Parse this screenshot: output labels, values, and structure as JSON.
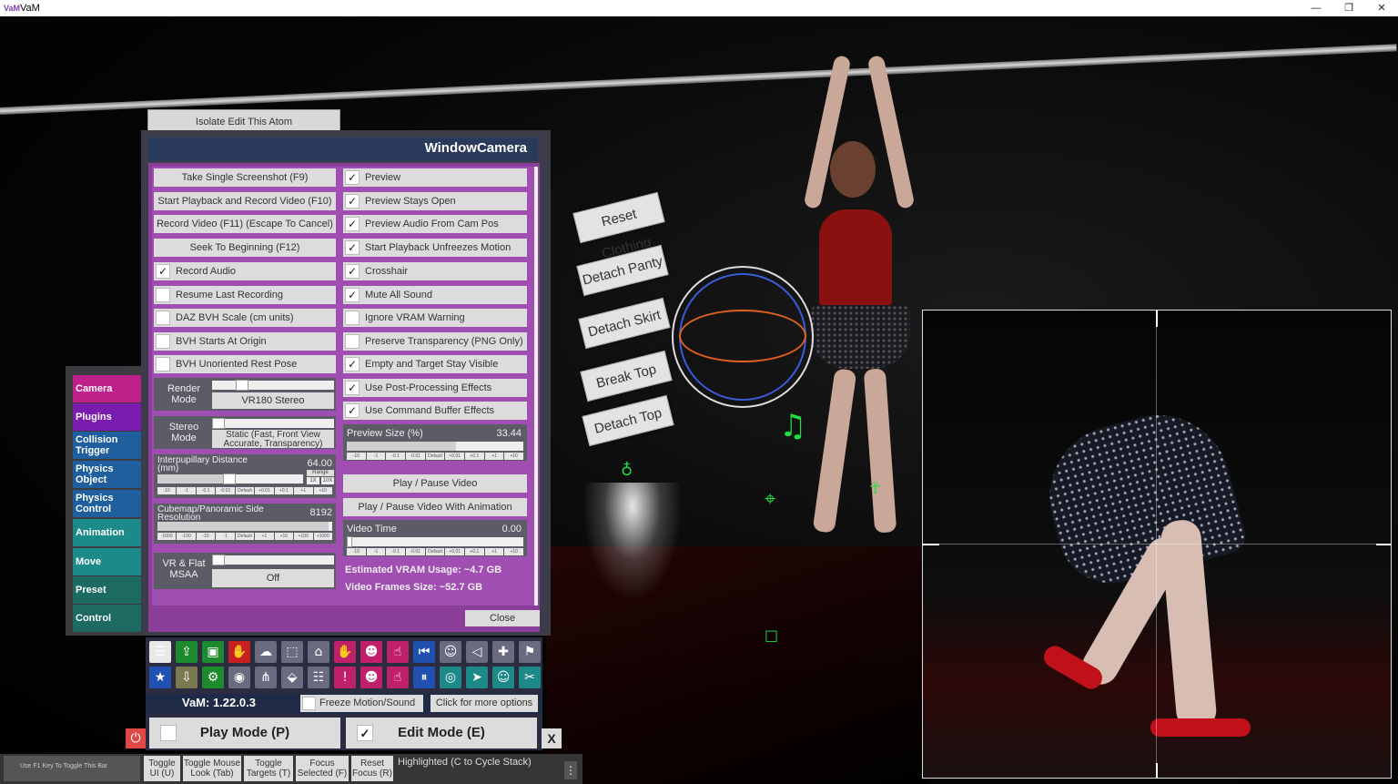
{
  "window": {
    "title": "VaM",
    "app_icon": "VaM",
    "min": "—",
    "restore": "❐",
    "close": "✕"
  },
  "scene": {
    "tags": [
      "Reset Clothing",
      "Detach Panty",
      "Detach Skirt",
      "Break Top",
      "Detach Top"
    ]
  },
  "isolate_button": "Isolate Edit This Atom",
  "tabs": [
    {
      "label": "Camera",
      "color": "#c0208a"
    },
    {
      "label": "Plugins",
      "color": "#7a1cae"
    },
    {
      "label": "Collision Trigger",
      "color": "#1f5f9e"
    },
    {
      "label": "Physics Object",
      "color": "#1f5f9e"
    },
    {
      "label": "Physics Control",
      "color": "#1f5f9e"
    },
    {
      "label": "Animation",
      "color": "#1c8a88"
    },
    {
      "label": "Move",
      "color": "#1c8a88"
    },
    {
      "label": "Preset",
      "color": "#1c6a60"
    },
    {
      "label": "Control",
      "color": "#1c6a60"
    }
  ],
  "panel": {
    "title": "WindowCamera",
    "left_buttons": [
      "Take Single Screenshot (F9)",
      "Start Playback and Record Video (F10)",
      "Record Video (F11) (Escape To Cancel)",
      "Seek To Beginning (F12)"
    ],
    "left_checks": [
      {
        "label": "Record Audio",
        "checked": "✓"
      },
      {
        "label": "Resume Last Recording",
        "checked": ""
      },
      {
        "label": "DAZ BVH Scale (cm units)",
        "checked": ""
      },
      {
        "label": "BVH Starts At Origin",
        "checked": ""
      },
      {
        "label": "BVH Unoriented Rest Pose",
        "checked": ""
      }
    ],
    "right_checks": [
      {
        "label": "Preview",
        "checked": "✓"
      },
      {
        "label": "Preview Stays Open",
        "checked": "✓"
      },
      {
        "label": "Preview Audio From Cam Pos",
        "checked": "✓"
      },
      {
        "label": "Start Playback Unfreezes Motion",
        "checked": "✓"
      },
      {
        "label": "Crosshair",
        "checked": "✓"
      },
      {
        "label": "Mute All Sound",
        "checked": "✓"
      },
      {
        "label": "Ignore VRAM Warning",
        "checked": ""
      },
      {
        "label": "Preserve Transparency (PNG Only)",
        "checked": ""
      },
      {
        "label": "Empty and Target Stay Visible",
        "checked": "✓"
      },
      {
        "label": "Use Post-Processing Effects",
        "checked": "✓"
      },
      {
        "label": "Use Command Buffer Effects",
        "checked": "✓"
      }
    ],
    "render_mode": {
      "label": "Render Mode",
      "value": "VR180 Stereo"
    },
    "stereo_mode": {
      "label": "Stereo Mode",
      "value": "Static (Fast, Front View Accurate, Transparency)"
    },
    "ipd": {
      "label": "Interpupillary Distance (mm)",
      "value": "64.00",
      "range_label": "Range",
      "range_1x": "1X",
      "range_10x": "10X"
    },
    "cubemap": {
      "label": "Cubemap/Panoramic Side Resolution",
      "value": "8192"
    },
    "msaa": {
      "label": "VR & Flat MSAA",
      "value": "Off"
    },
    "preview_size": {
      "label": "Preview Size (%)",
      "value": "33.44",
      "fraction": 0.62
    },
    "play_pause": "Play / Pause Video",
    "play_pause_anim": "Play / Pause Video With Animation",
    "video_time": {
      "label": "Video Time",
      "value": "0.00"
    },
    "vram": "Estimated VRAM Usage: ~4.7 GB",
    "frames": "Video Frames Size: ~52.7 GB",
    "close": "Close",
    "stepper_small": [
      "-10",
      "-1",
      "-0.1",
      "-0.01",
      "Default",
      "+0.01",
      "+0.1",
      "+1",
      "+10"
    ],
    "stepper_big": [
      "-1000",
      "-100",
      "-10",
      "-1",
      "Default",
      "+1",
      "+10",
      "+100",
      "+1000"
    ]
  },
  "toolbar": {
    "row1": [
      {
        "icon": "☰",
        "name": "menu-icon",
        "color": "#e8e8e8"
      },
      {
        "icon": "⇪",
        "name": "open-scene-icon",
        "color": "#1e8a2e"
      },
      {
        "icon": "▣",
        "name": "folder-icon",
        "color": "#1e8a2e"
      },
      {
        "icon": "✋",
        "name": "hand-red-icon",
        "color": "#c82020"
      },
      {
        "icon": "☁",
        "name": "cloud-icon",
        "color": "#6a6a80"
      },
      {
        "icon": "⬚",
        "name": "cube-icon",
        "color": "#6a6a80"
      },
      {
        "icon": "⌂",
        "name": "hub-icon",
        "color": "#6a6a80"
      },
      {
        "icon": "✋",
        "name": "grab-icon",
        "color": "#c0206a"
      },
      {
        "icon": "☻",
        "name": "person-add-icon",
        "color": "#c0206a"
      },
      {
        "icon": "☝",
        "name": "pointer-hand-icon",
        "color": "#c0206a"
      },
      {
        "icon": "⏮",
        "name": "rewind-icon",
        "color": "#2050b0"
      },
      {
        "icon": "☺",
        "name": "person-icon",
        "color": "#6a6a80"
      },
      {
        "icon": "◁",
        "name": "unity-icon",
        "color": "#6a6a80"
      },
      {
        "icon": "✚",
        "name": "add-icon",
        "color": "#6a6a80"
      },
      {
        "icon": "⚑",
        "name": "flag-icon",
        "color": "#6a6a80"
      }
    ],
    "row2": [
      {
        "icon": "★",
        "name": "star-icon",
        "color": "#2050b0"
      },
      {
        "icon": "⇩",
        "name": "load-icon",
        "color": "#7a7a50"
      },
      {
        "icon": "⚙",
        "name": "screenshot-icon",
        "color": "#1e8a2e"
      },
      {
        "icon": "◉",
        "name": "camera-icon",
        "color": "#6a6a80"
      },
      {
        "icon": "⋔",
        "name": "tree-icon",
        "color": "#6a6a80"
      },
      {
        "icon": "⬙",
        "name": "package-icon",
        "color": "#6a6a80"
      },
      {
        "icon": "☷",
        "name": "document-icon",
        "color": "#6a6a80"
      },
      {
        "icon": "!",
        "name": "alert-icon",
        "color": "#c0206a"
      },
      {
        "icon": "☻",
        "name": "person-remove-icon",
        "color": "#c0206a"
      },
      {
        "icon": "☝",
        "name": "hand-icon",
        "color": "#c0206a"
      },
      {
        "icon": "⏸",
        "name": "pause-icon",
        "color": "#2050b0"
      },
      {
        "icon": "◎",
        "name": "target-icon",
        "color": "#1c8a88"
      },
      {
        "icon": "➤",
        "name": "select-icon",
        "color": "#1c8a88"
      },
      {
        "icon": "☺",
        "name": "people-icon",
        "color": "#1c8a88"
      },
      {
        "icon": "✂",
        "name": "tools-icon",
        "color": "#1c8a88"
      }
    ]
  },
  "status": {
    "version": "VaM: 1.22.0.3",
    "freeze": "Freeze Motion/Sound",
    "more_options": "Click for more options"
  },
  "modes": {
    "play": "Play Mode (P)",
    "edit": "Edit Mode (E)",
    "edit_check": "✓",
    "close": "X",
    "power": "⏻"
  },
  "hintbar": {
    "f1": "Use F1 Key To Toggle This Bar",
    "buttons": [
      "Toggle UI (U)",
      "Toggle Mouse Look (Tab)",
      "Toggle Targets (T)",
      "Focus Selected (F)",
      "Reset Focus (R)"
    ],
    "highlighted": "Highlighted (C to Cycle Stack)",
    "menu": "⋮"
  }
}
